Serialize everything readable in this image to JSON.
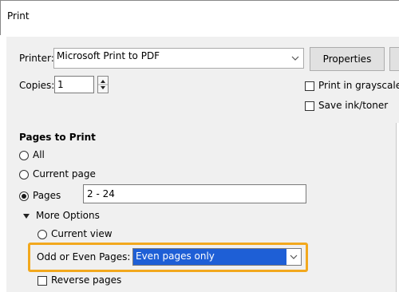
{
  "window": {
    "title": "Print"
  },
  "printer": {
    "label": "Printer:",
    "value": "Microsoft Print to PDF",
    "properties_label": "Properties"
  },
  "copies": {
    "label": "Copies:",
    "value": "1"
  },
  "options": {
    "grayscale_label": "Print in grayscale",
    "save_ink_label": "Save ink/toner"
  },
  "pages_to_print": {
    "heading": "Pages to Print",
    "all_label": "All",
    "current_page_label": "Current page",
    "pages_label": "Pages",
    "pages_value": "2 - 24",
    "more_options_label": "More Options",
    "current_view_label": "Current view",
    "odd_even_label": "Odd or Even Pages:",
    "odd_even_value": "Even pages only",
    "reverse_label": "Reverse pages"
  },
  "colors": {
    "highlight": "#f2a81d",
    "selection": "#1e5fd6"
  }
}
